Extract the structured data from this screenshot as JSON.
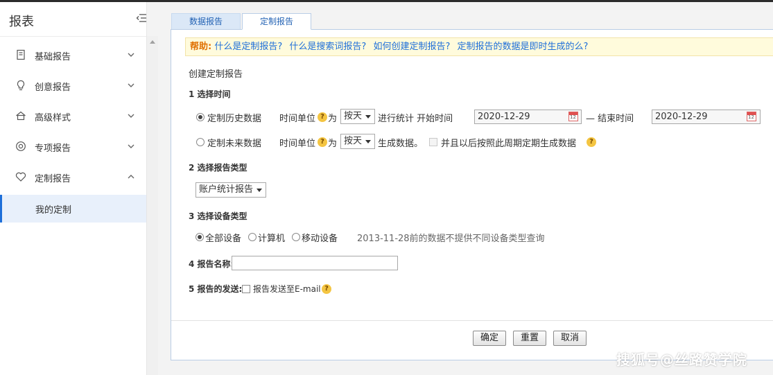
{
  "sidebar": {
    "title": "报表",
    "items": [
      {
        "label": "基础报告",
        "icon": "document-icon",
        "expanded": false
      },
      {
        "label": "创意报告",
        "icon": "lightbulb-icon",
        "expanded": false
      },
      {
        "label": "高级样式",
        "icon": "home-icon",
        "expanded": false
      },
      {
        "label": "专项报告",
        "icon": "target-icon",
        "expanded": false
      },
      {
        "label": "定制报告",
        "icon": "heart-icon",
        "expanded": true
      }
    ],
    "sub_items": [
      {
        "label": "我的定制",
        "active": true
      }
    ]
  },
  "tabs": [
    {
      "label": "数据报告",
      "active": false
    },
    {
      "label": "定制报告",
      "active": true
    }
  ],
  "help": {
    "label": "帮助:",
    "links": [
      "什么是定制报告?",
      "什么是搜索词报告?",
      "如何创建定制报告?",
      "定制报告的数据是即时生成的么?"
    ]
  },
  "form": {
    "title": "创建定制报告",
    "step1": {
      "heading": "1 选择时间",
      "history_label": "定制历史数据",
      "unit_label": "时间单位",
      "unit_suffix": "为",
      "unit_value": "按天",
      "stat_text": "进行统计 开始时间",
      "start_date": "2020-12-29",
      "end_label": "— 结束时间",
      "end_date": "2020-12-29",
      "future_label": "定制未来数据",
      "future_unit_value": "按天",
      "future_text": "生成数据。",
      "periodic_label": "并且以后按照此周期定期生成数据"
    },
    "step2": {
      "heading": "2 选择报告类型",
      "report_type": "账户统计报告"
    },
    "step3": {
      "heading": "3 选择设备类型",
      "options": [
        "全部设备",
        "计算机",
        "移动设备"
      ],
      "note": "2013-11-28前的数据不提供不同设备类型查询"
    },
    "step4": {
      "heading": "4 报告名称:",
      "value": ""
    },
    "step5": {
      "heading": "5 报告的发送:",
      "email_label": "报告发送至E-mail"
    }
  },
  "buttons": {
    "confirm": "确定",
    "reset": "重置",
    "cancel": "取消"
  },
  "watermark": "搜狐号@丝路赞学院",
  "colors": {
    "accent": "#1e6fd9",
    "help_bg": "#fffbdc",
    "help_label": "#e07000",
    "question_badge": "#f4c542"
  }
}
